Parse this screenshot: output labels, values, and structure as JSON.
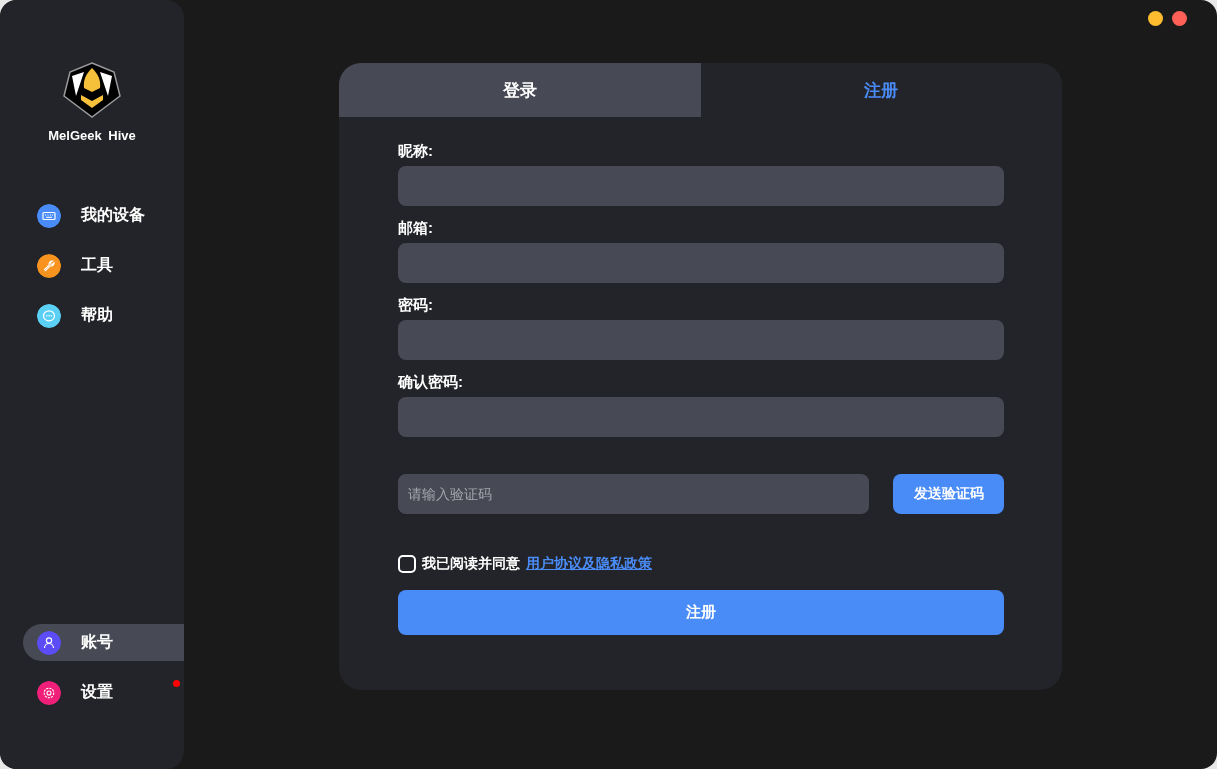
{
  "app": {
    "name": "MelGeek Hive"
  },
  "window_controls": [
    {
      "color": "#febc2e"
    },
    {
      "color": "#fe5f57"
    }
  ],
  "nav": [
    {
      "label": "我的设备",
      "color": "#4a8cf7",
      "selected": false,
      "badge": false
    },
    {
      "label": "工具",
      "color": "#f7931e",
      "selected": false,
      "badge": false
    },
    {
      "label": "帮助",
      "color": "#5ad0f5",
      "selected": false,
      "badge": false
    }
  ],
  "nav_bottom": [
    {
      "label": "账号",
      "color": "#5b4cf5",
      "selected": true,
      "badge": false
    },
    {
      "label": "设置",
      "color": "#f0207a",
      "selected": false,
      "badge": true
    }
  ],
  "tabs": [
    {
      "label": "登录",
      "selected": false
    },
    {
      "label": "注册",
      "selected": true
    }
  ],
  "fields": [
    {
      "label": "昵称:"
    },
    {
      "label": "邮箱:"
    },
    {
      "label": "密码:"
    },
    {
      "label": "确认密码:"
    }
  ],
  "code_field": {
    "placeholder": "请输入验证码"
  },
  "send_code_button": "发送验证码",
  "agreement": {
    "text": "我已阅读并同意",
    "link": "用户协议及隐私政策",
    "checked": false
  },
  "submit_button": "注册"
}
